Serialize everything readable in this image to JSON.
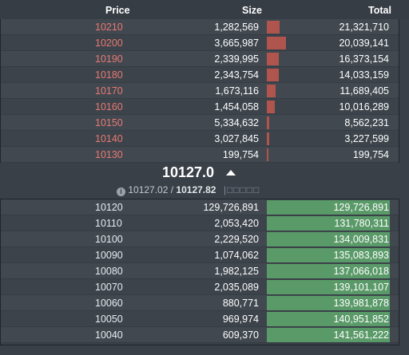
{
  "header": {
    "price_label": "Price",
    "size_label": "Size",
    "total_label": "Total"
  },
  "asks": [
    {
      "price": "10210",
      "size": "1,282,569",
      "total": "21,321,710",
      "depth": 0.65
    },
    {
      "price": "10200",
      "size": "3,665,987",
      "total": "20,039,141",
      "depth": 1.0
    },
    {
      "price": "10190",
      "size": "2,339,995",
      "total": "16,373,154",
      "depth": 0.64
    },
    {
      "price": "10180",
      "size": "2,343,754",
      "total": "14,033,159",
      "depth": 0.64
    },
    {
      "price": "10170",
      "size": "1,673,116",
      "total": "11,689,405",
      "depth": 0.46
    },
    {
      "price": "10160",
      "size": "1,454,058",
      "total": "10,016,289",
      "depth": 0.4
    },
    {
      "price": "10150",
      "size": "5,334,632",
      "total": "8,562,231",
      "depth": 0.12
    },
    {
      "price": "10140",
      "size": "3,027,845",
      "total": "3,227,599",
      "depth": 0.14
    },
    {
      "price": "10130",
      "size": "199,754",
      "total": "199,754",
      "depth": 0.05
    }
  ],
  "mid": {
    "last_price": "10127.0",
    "direction": "up",
    "fair_price": "10127.02",
    "separator": " / ",
    "mark_price": "10127.82",
    "extra": "|□□□□□"
  },
  "bids": [
    {
      "price": "10120",
      "size": "129,726,891",
      "total": "129,726,891"
    },
    {
      "price": "10110",
      "size": "2,053,420",
      "total": "131,780,311"
    },
    {
      "price": "10100",
      "size": "2,229,520",
      "total": "134,009,831"
    },
    {
      "price": "10090",
      "size": "1,074,062",
      "total": "135,083,893"
    },
    {
      "price": "10080",
      "size": "1,982,125",
      "total": "137,066,018"
    },
    {
      "price": "10070",
      "size": "2,035,089",
      "total": "139,101,107"
    },
    {
      "price": "10060",
      "size": "880,771",
      "total": "139,981,878"
    },
    {
      "price": "10050",
      "size": "969,974",
      "total": "140,951,852"
    },
    {
      "price": "10040",
      "size": "609,370",
      "total": "141,561,222"
    }
  ],
  "colors": {
    "ask_price": "#e87a72",
    "ask_bar": "#b0554d",
    "bid_bar": "#5a9a69",
    "background": "#3a4048"
  },
  "icons": {
    "info": "info-circle-icon",
    "tick_up": "triangle-up-icon"
  }
}
